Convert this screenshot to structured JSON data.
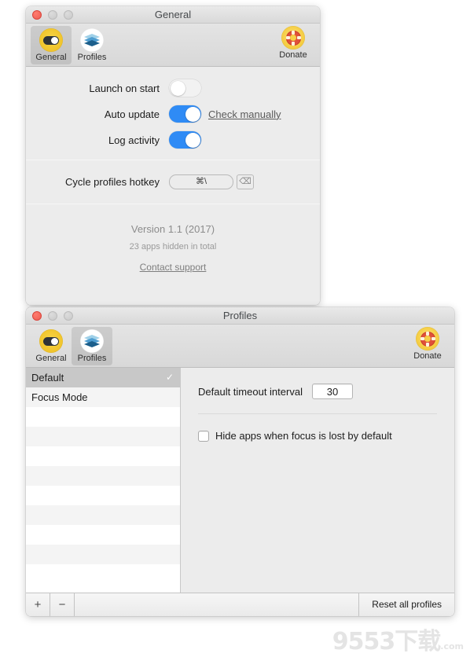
{
  "general_window": {
    "title": "General",
    "traffic_lights": {
      "close": "close-button",
      "minimize": "minimize-button",
      "maximize": "maximize-button"
    },
    "toolbar": {
      "items": [
        {
          "label": "General",
          "icon": "toggle-switch-icon",
          "selected": true
        },
        {
          "label": "Profiles",
          "icon": "layers-stack-icon",
          "selected": false
        }
      ],
      "donate": {
        "label": "Donate",
        "icon": "life-ring-icon"
      }
    },
    "settings": [
      {
        "label": "Launch on start",
        "state": "off",
        "link": null
      },
      {
        "label": "Auto update",
        "state": "on",
        "link": "Check manually"
      },
      {
        "label": "Log activity",
        "state": "on",
        "link": null
      }
    ],
    "hotkey": {
      "label": "Cycle profiles hotkey",
      "value": "⌘\\",
      "clear_icon": "⌫"
    },
    "about": {
      "version": "Version 1.1 (2017)",
      "count": "23 apps hidden in total",
      "support_link": "Contact support"
    }
  },
  "profiles_window": {
    "title": "Profiles",
    "toolbar": {
      "items": [
        {
          "label": "General",
          "icon": "toggle-switch-icon",
          "selected": false
        },
        {
          "label": "Profiles",
          "icon": "layers-stack-icon",
          "selected": true
        }
      ],
      "donate": {
        "label": "Donate",
        "icon": "life-ring-icon"
      }
    },
    "list": {
      "rows": [
        {
          "name": "Default",
          "selected": true,
          "checked": true
        },
        {
          "name": "Focus Mode",
          "selected": false,
          "checked": false
        },
        {
          "name": "",
          "selected": false,
          "checked": false
        },
        {
          "name": "",
          "selected": false,
          "checked": false
        },
        {
          "name": "",
          "selected": false,
          "checked": false
        },
        {
          "name": "",
          "selected": false,
          "checked": false
        },
        {
          "name": "",
          "selected": false,
          "checked": false
        },
        {
          "name": "",
          "selected": false,
          "checked": false
        },
        {
          "name": "",
          "selected": false,
          "checked": false
        },
        {
          "name": "",
          "selected": false,
          "checked": false
        },
        {
          "name": "",
          "selected": false,
          "checked": false
        }
      ],
      "check_glyph": "✓"
    },
    "detail": {
      "timeout_label": "Default timeout interval",
      "timeout_value": "30",
      "hide_apps_label": "Hide apps when focus is lost by default",
      "hide_apps_checked": false
    },
    "footer": {
      "add_label": "+",
      "remove_label": "−",
      "reset_label": "Reset all profiles"
    }
  },
  "watermark": {
    "main": "9553",
    "cn": "下载",
    "sub": ".com"
  },
  "colors": {
    "accent_blue": "#2f8bf5",
    "icon_yellow": "#f2c72f",
    "icon_blue": "#3d8fc4",
    "donate_red": "#e0503a",
    "window_bg": "#ececec",
    "selection_gray": "#c8c8c8"
  }
}
